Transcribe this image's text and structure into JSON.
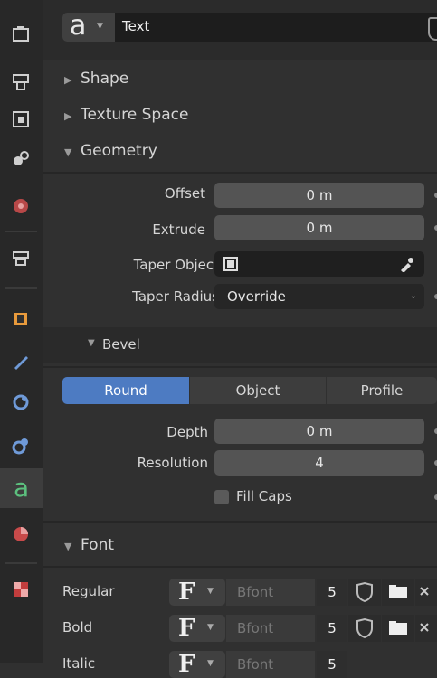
{
  "header": {
    "datablock_name": "Text"
  },
  "sections": {
    "shape": "Shape",
    "texture_space": "Texture Space",
    "geometry": "Geometry",
    "bevel": "Bevel",
    "font": "Font"
  },
  "geometry": {
    "offset_label": "Offset",
    "offset_value": "0 m",
    "extrude_label": "Extrude",
    "extrude_value": "0 m",
    "taper_object_label": "Taper Object",
    "taper_radius_label": "Taper Radius",
    "taper_radius_value": "Override"
  },
  "bevel": {
    "modes": [
      "Round",
      "Object",
      "Profile"
    ],
    "active_mode": "Round",
    "depth_label": "Depth",
    "depth_value": "0 m",
    "resolution_label": "Resolution",
    "resolution_value": "4",
    "fill_caps_label": "Fill Caps"
  },
  "font": {
    "rows": [
      {
        "label": "Regular",
        "font": "Bfont",
        "users": "5"
      },
      {
        "label": "Bold",
        "font": "Bfont",
        "users": "5"
      },
      {
        "label": "Italic",
        "font": "Bfont",
        "users": "5"
      }
    ]
  },
  "colors": {
    "active_tab": "#4d7bc2",
    "background": "#303030",
    "field": "#545454"
  }
}
